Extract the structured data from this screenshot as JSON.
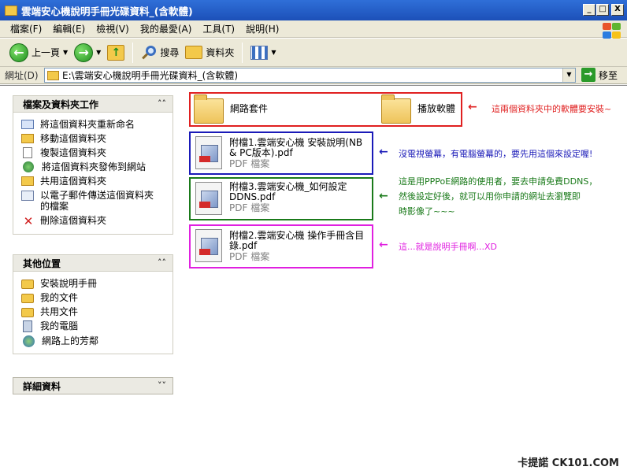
{
  "window": {
    "title": "雲端安心機說明手冊光碟資料_(含軟體)",
    "controls": {
      "minimize": "_",
      "maximize": "□",
      "close": "X"
    }
  },
  "menu": {
    "items": [
      "檔案(F)",
      "編輯(E)",
      "檢視(V)",
      "我的最愛(A)",
      "工具(T)",
      "說明(H)"
    ]
  },
  "toolbar": {
    "back_label": "上一頁",
    "search_label": "搜尋",
    "folders_label": "資料夾"
  },
  "address": {
    "label": "網址(D)",
    "value": "E:\\雲端安心機說明手冊光碟資料_(含軟體)",
    "go_label": "移至"
  },
  "sidebar": {
    "tasks": {
      "title": "檔案及資料夾工作",
      "items": [
        {
          "label": "將這個資料夾重新命名",
          "icon": "rename-icon"
        },
        {
          "label": "移動這個資料夾",
          "icon": "move-icon"
        },
        {
          "label": "複製這個資料夾",
          "icon": "copy-icon"
        },
        {
          "label": "將這個資料夾發佈到網站",
          "icon": "publish-icon"
        },
        {
          "label": "共用這個資料夾",
          "icon": "share-icon"
        },
        {
          "label": "以電子郵件傳送這個資料夾的檔案",
          "icon": "email-icon"
        },
        {
          "label": "刪除這個資料夾",
          "icon": "delete-icon"
        }
      ]
    },
    "places": {
      "title": "其他位置",
      "items": [
        {
          "label": "安裝說明手冊",
          "icon": "folder-icon"
        },
        {
          "label": "我的文件",
          "icon": "my-documents-icon"
        },
        {
          "label": "共用文件",
          "icon": "folder-icon"
        },
        {
          "label": "我的電腦",
          "icon": "computer-icon"
        },
        {
          "label": "網路上的芳鄰",
          "icon": "network-icon"
        }
      ]
    },
    "details": {
      "title": "詳細資料"
    }
  },
  "files": {
    "folder1": "網路套件",
    "folder2": "播放軟體",
    "pdf1": {
      "name": "附檔1.雲端安心機 安裝說明(NB & PC版本).pdf",
      "type": "PDF 檔案"
    },
    "pdf2": {
      "name": "附檔3.雲端安心機_如何設定DDNS.pdf",
      "type": "PDF 檔案"
    },
    "pdf3": {
      "name": "附檔2.雲端安心機 操作手冊含目錄.pdf",
      "type": "PDF 檔案"
    }
  },
  "notes": {
    "n1": "這兩個資料夾中的軟體要安裝~",
    "n2": "沒電視螢幕，有電腦螢幕的，要先用這個來設定喔!",
    "n3_line1": "這是用PPPoE網路的使用者，要去申請免費DDNS，",
    "n3_line2": "然後設定好後，就可以用你申請的網址去瀏覽即",
    "n3_line3": "時影像了~~~",
    "n4": "這...就是說明手冊啊...XD"
  },
  "watermark": "卡提諾 CK101.COM",
  "colors": {
    "red": "#e02020",
    "blue": "#1a1ab8",
    "green": "#1a7a1a",
    "magenta": "#e020e0"
  }
}
